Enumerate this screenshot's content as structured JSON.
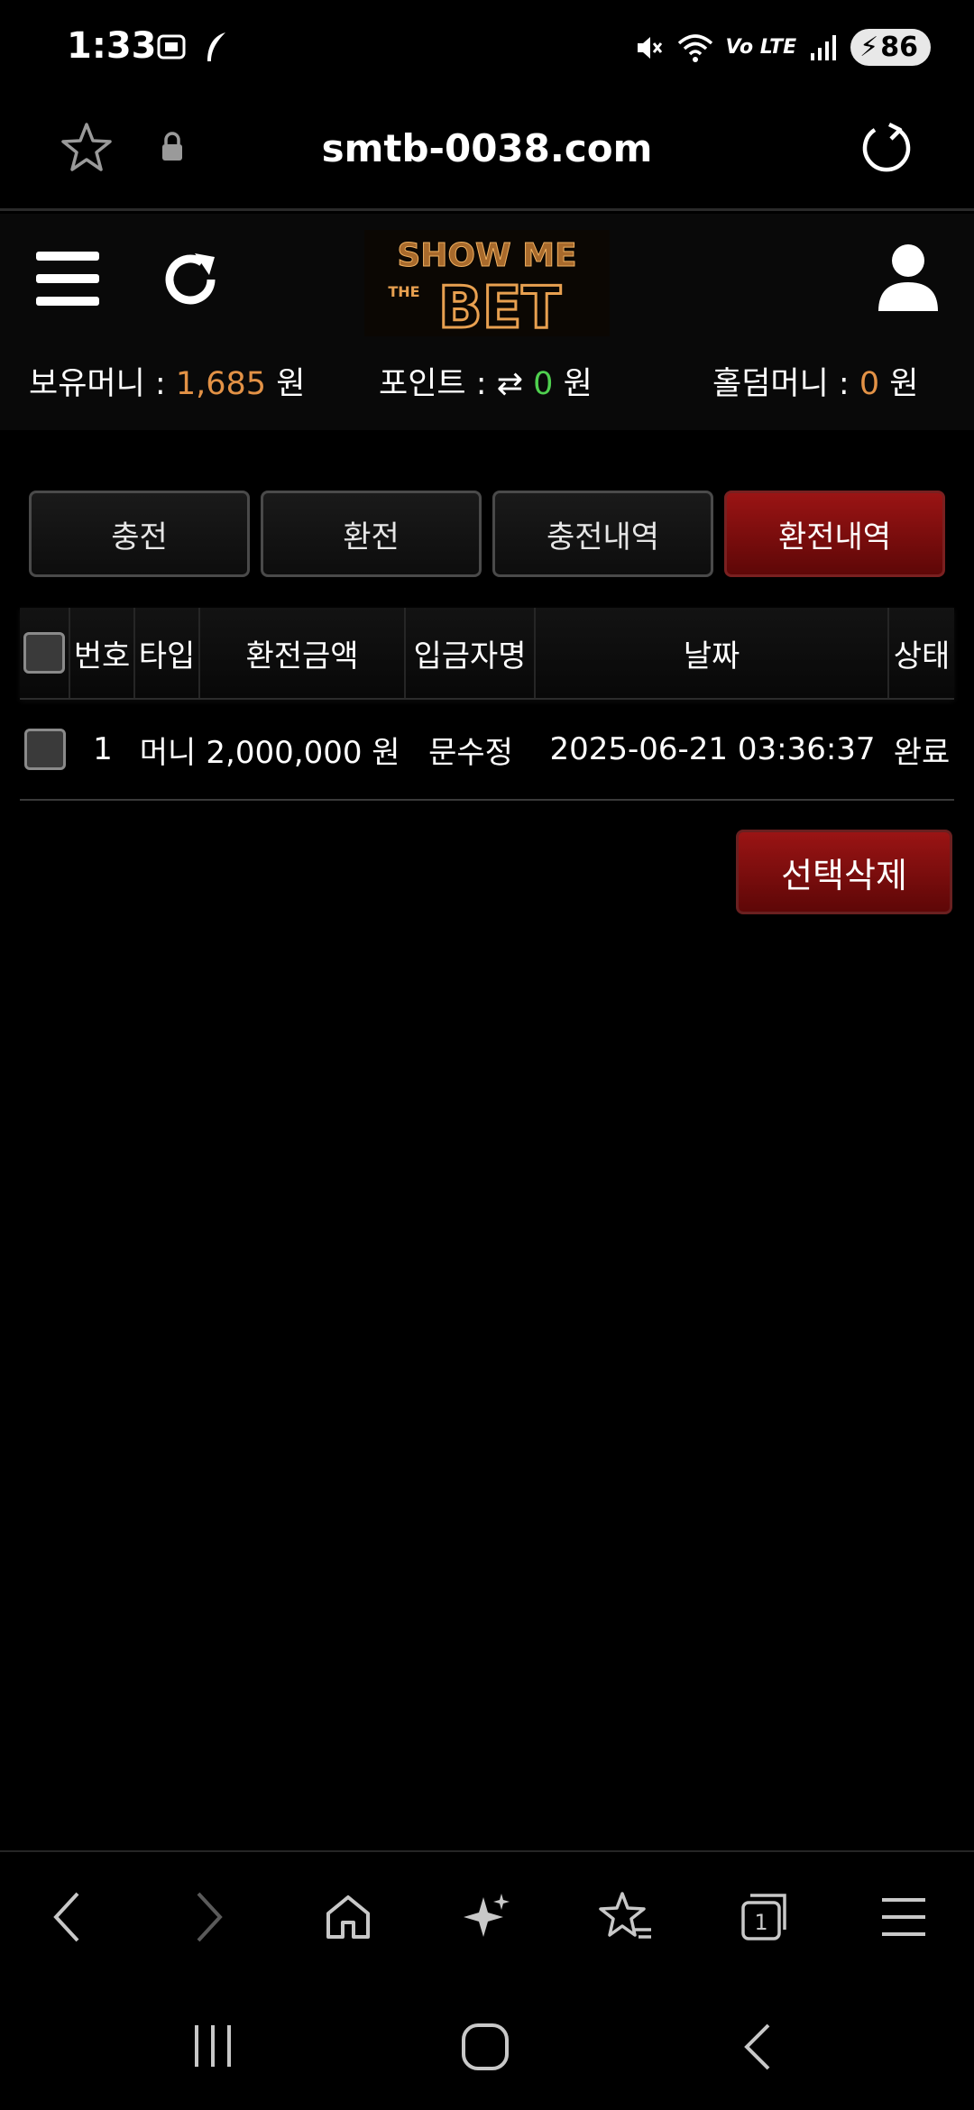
{
  "status_bar": {
    "time": "1:33",
    "lte_label": "Vo LTE",
    "battery": "86"
  },
  "browser": {
    "url": "smtb-0038.com"
  },
  "site": {
    "logo_text": "SHOW ME THE BET",
    "balances": {
      "money_label": "보유머니 :",
      "money_value": "1,685",
      "money_unit": "원",
      "point_label": "포인트 :",
      "point_value": "0",
      "point_unit": "원",
      "holdem_label": "홀덤머니 :",
      "holdem_value": "0",
      "holdem_unit": "원"
    },
    "tabs": [
      {
        "label": "충전",
        "active": false
      },
      {
        "label": "환전",
        "active": false
      },
      {
        "label": "충전내역",
        "active": false
      },
      {
        "label": "환전내역",
        "active": true
      }
    ],
    "table": {
      "headers": [
        "번호",
        "타입",
        "환전금액",
        "입금자명",
        "날짜",
        "상태"
      ],
      "rows": [
        {
          "no": "1",
          "type": "머니",
          "amount": "2,000,000 원",
          "depositor": "문수정",
          "date": "2025-06-21 03:36:37",
          "status": "완료"
        }
      ]
    },
    "delete_button": "선택삭제"
  },
  "colors": {
    "accent_red": "#8b1010",
    "money_orange": "#e39246",
    "point_green": "#4fd04f",
    "background": "#000000"
  }
}
